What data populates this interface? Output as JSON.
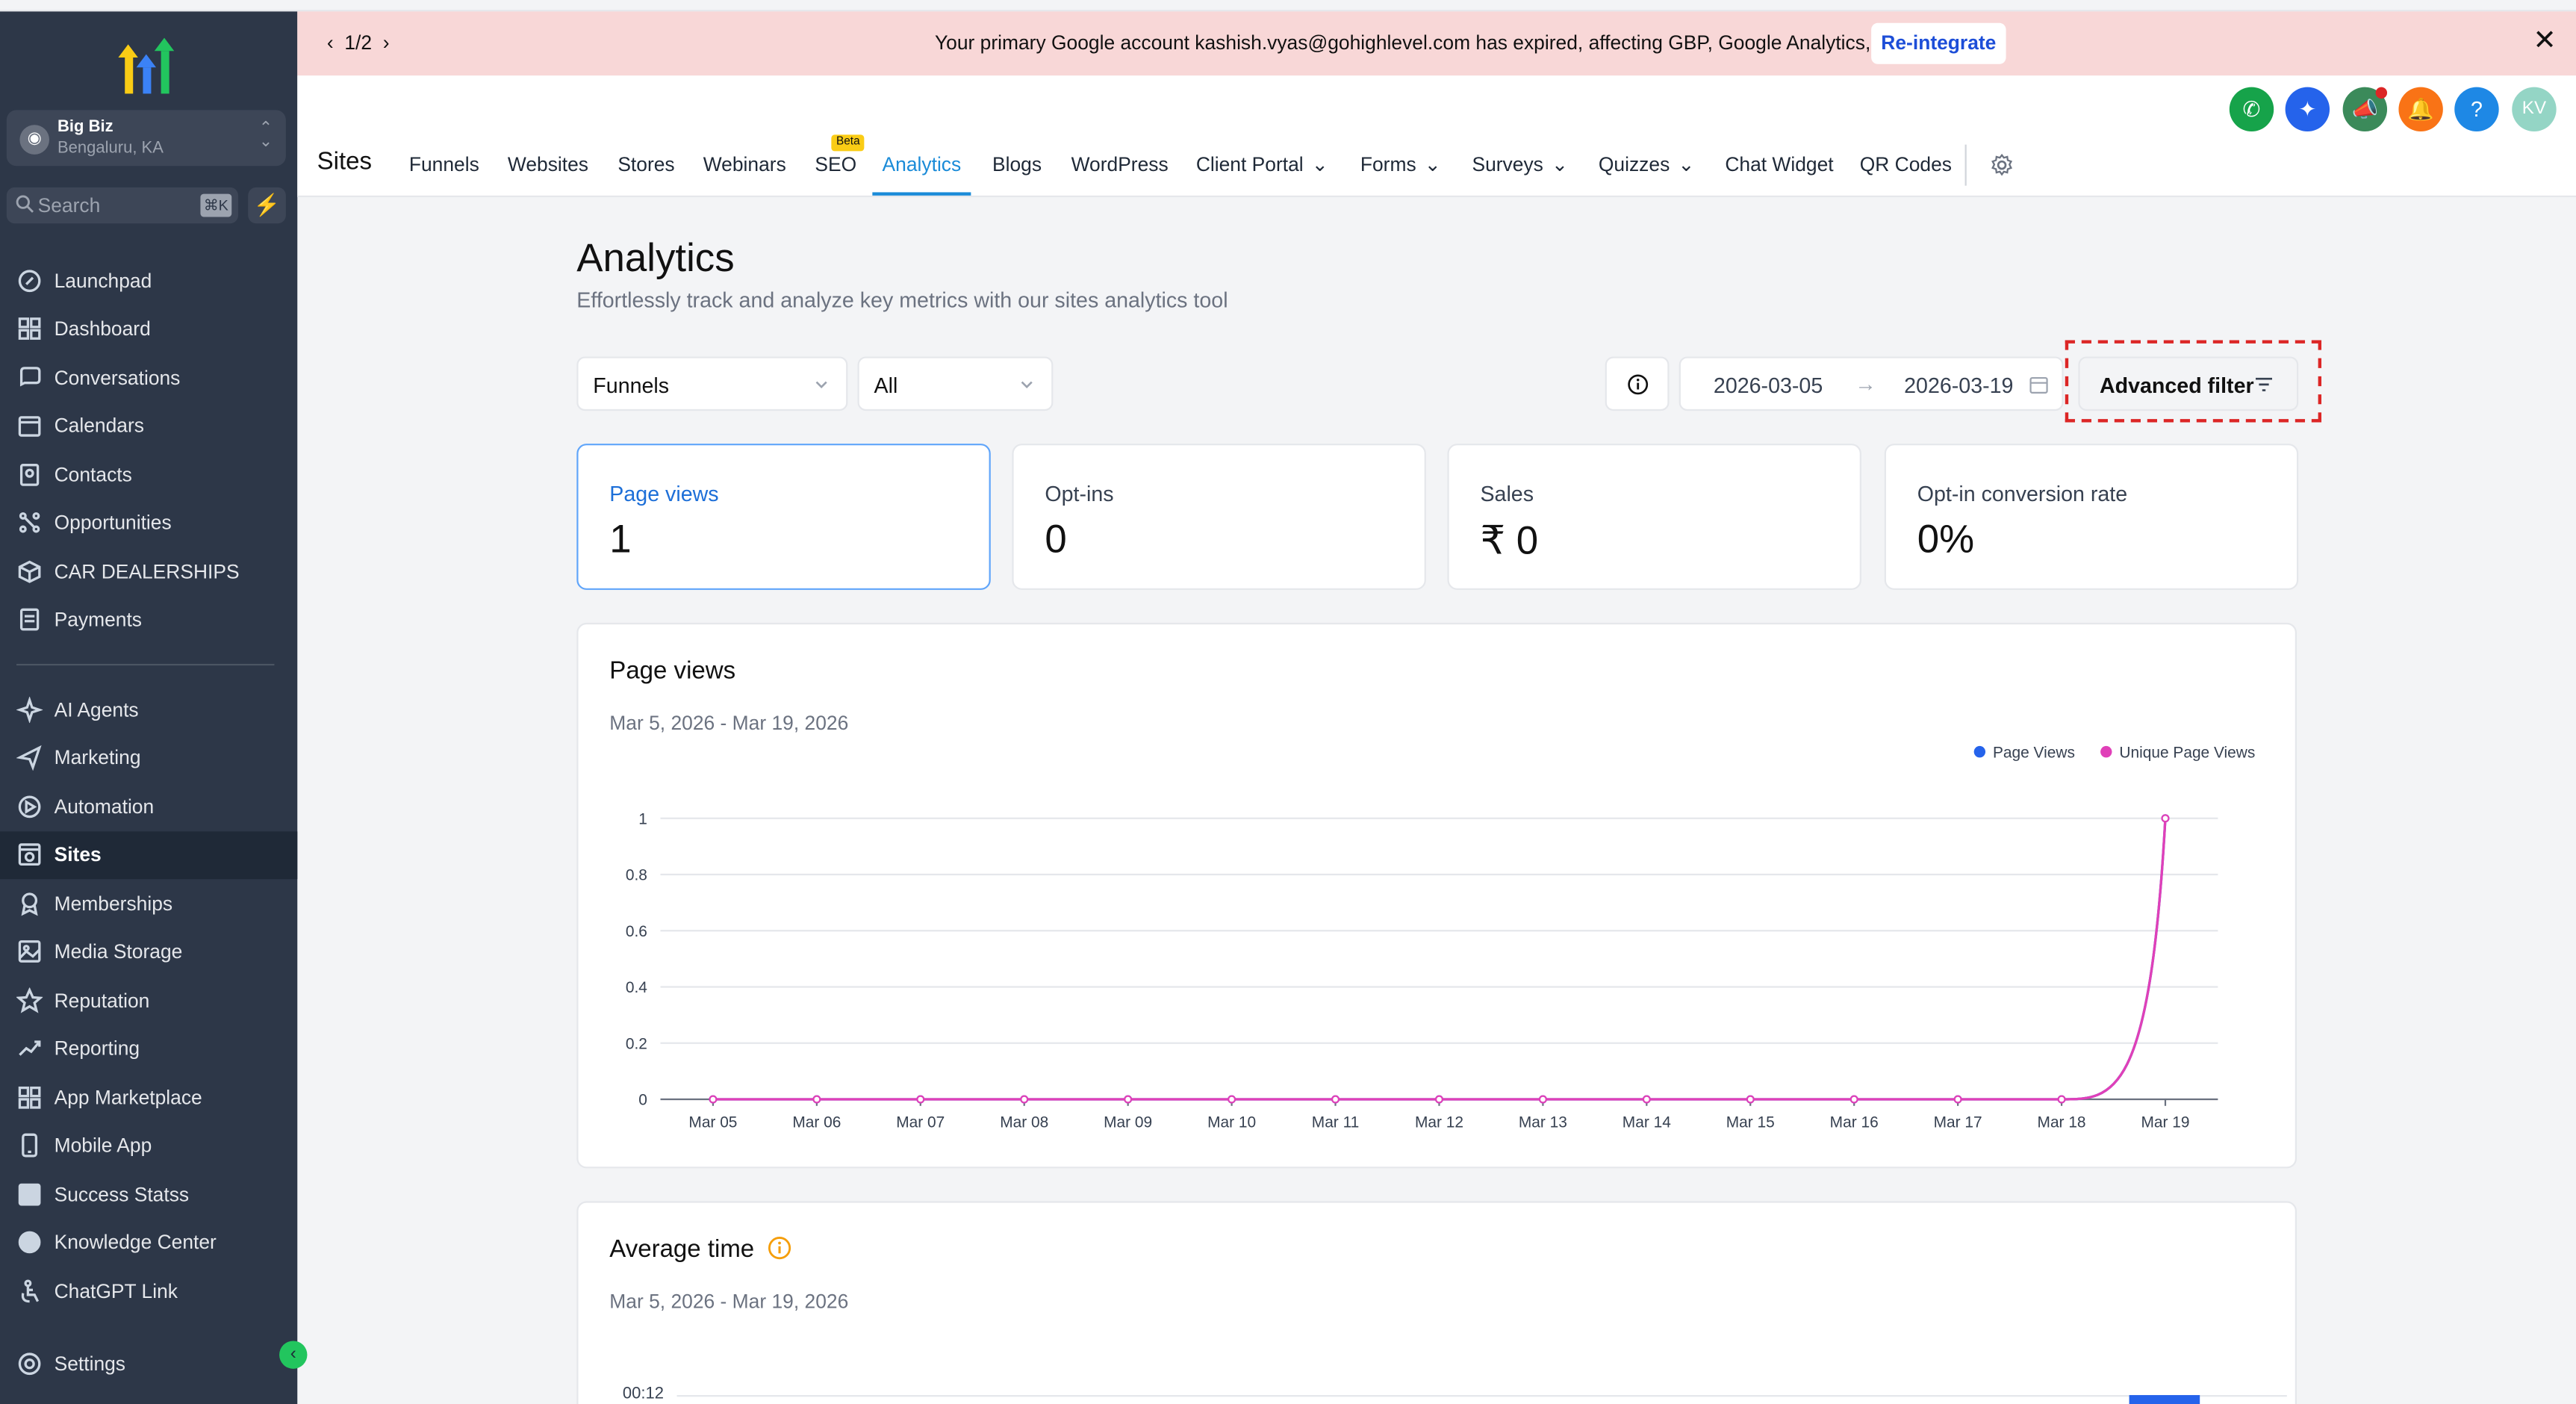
{
  "sidebar": {
    "account_name": "Big Biz",
    "account_location": "Bengaluru, KA",
    "search_placeholder": "Search",
    "search_shortcut": "⌘K",
    "items_top": [
      "Launchpad",
      "Dashboard",
      "Conversations",
      "Calendars",
      "Contacts",
      "Opportunities",
      "CAR DEALERSHIPS",
      "Payments"
    ],
    "items_bottom": [
      "AI Agents",
      "Marketing",
      "Automation",
      "Sites",
      "Memberships",
      "Media Storage",
      "Reputation",
      "Reporting",
      "App Marketplace",
      "Mobile App",
      "Success Statss",
      "Knowledge Center",
      "ChatGPT Link"
    ],
    "active_item": "Sites",
    "settings_label": "Settings"
  },
  "banner": {
    "pager": "1/2",
    "message": "Your primary Google account kashish.vyas@gohighlevel.com has expired, affecting GBP, Google Analytics, etc.",
    "button": "Re-integrate"
  },
  "header": {
    "section_title": "Sites",
    "tabs": [
      "Funnels",
      "Websites",
      "Stores",
      "Webinars",
      "SEO",
      "Analytics",
      "Blogs",
      "WordPress",
      "Client Portal",
      "Forms",
      "Surveys",
      "Quizzes",
      "Chat Widget",
      "QR Codes"
    ],
    "active_tab": "Analytics",
    "beta_badge": "Beta",
    "avatar_initials": "KV",
    "colors": {
      "phone": "#16a34a",
      "spark": "#2563eb",
      "megaphone": "#3b8a5a",
      "bell": "#f97316",
      "help": "#1e88e5",
      "avatar": "#94d5c5"
    }
  },
  "main": {
    "title": "Analytics",
    "subtitle": "Effortlessly track and analyze key metrics with our sites analytics tool",
    "filter_type": "Funnels",
    "filter_item": "All",
    "date_start": "2026-03-05",
    "date_end": "2026-03-19",
    "advanced_filter": "Advanced filter",
    "stats": [
      {
        "label": "Page views",
        "value": "1"
      },
      {
        "label": "Opt-ins",
        "value": "0"
      },
      {
        "label": "Sales",
        "value": "₹ 0"
      },
      {
        "label": "Opt-in conversion rate",
        "value": "0%"
      }
    ],
    "pageviews_panel": {
      "title": "Page views",
      "range": "Mar 5, 2026 - Mar 19, 2026"
    },
    "avgtime_panel": {
      "title": "Average time",
      "range": "Mar 5, 2026 - Mar 19, 2026",
      "first_tick": "00:12"
    }
  },
  "chart_data": {
    "type": "line",
    "categories": [
      "Mar 05",
      "Mar 06",
      "Mar 07",
      "Mar 08",
      "Mar 09",
      "Mar 10",
      "Mar 11",
      "Mar 12",
      "Mar 13",
      "Mar 14",
      "Mar 15",
      "Mar 16",
      "Mar 17",
      "Mar 18",
      "Mar 19"
    ],
    "series": [
      {
        "name": "Page Views",
        "color": "#2563eb",
        "values": [
          0,
          0,
          0,
          0,
          0,
          0,
          0,
          0,
          0,
          0,
          0,
          0,
          0,
          0,
          1
        ]
      },
      {
        "name": "Unique Page Views",
        "color": "#e040b8",
        "values": [
          0,
          0,
          0,
          0,
          0,
          0,
          0,
          0,
          0,
          0,
          0,
          0,
          0,
          0,
          1
        ]
      }
    ],
    "yticks": [
      "0",
      "0.2",
      "0.4",
      "0.6",
      "0.8",
      "1"
    ],
    "ylim": [
      0,
      1
    ],
    "grid": true,
    "legend": "top-right"
  }
}
